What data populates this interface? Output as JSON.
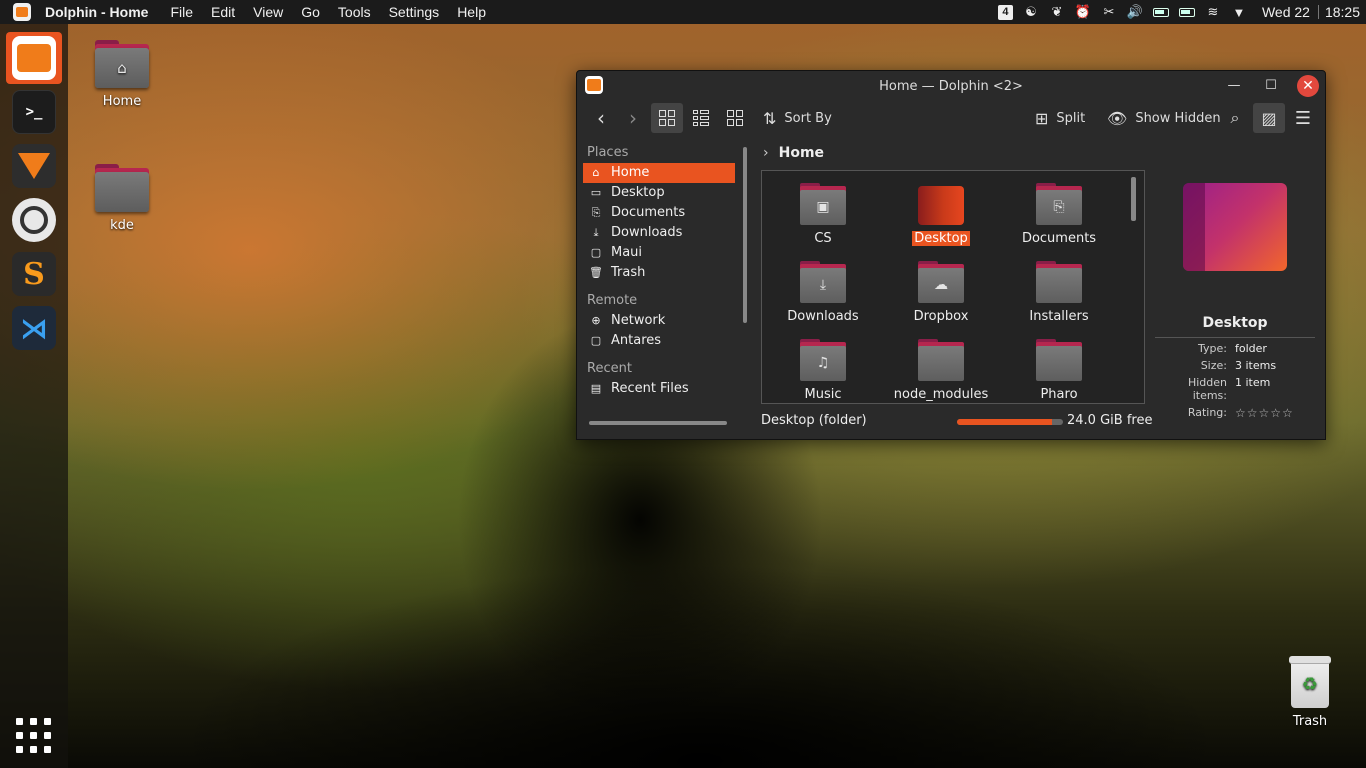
{
  "topbar": {
    "app_title": "Dolphin - Home",
    "menu": [
      "File",
      "Edit",
      "View",
      "Go",
      "Tools",
      "Settings",
      "Help"
    ],
    "tray_badge": "4",
    "date": "Wed 22",
    "time": "18:25"
  },
  "desktop": {
    "icons": [
      {
        "label": "Home",
        "icon": "home-icon"
      },
      {
        "label": "kde",
        "icon": "folder-icon"
      }
    ],
    "trash_label": "Trash"
  },
  "window": {
    "title": "Home — Dolphin <2>",
    "toolbar": {
      "sort_label": "Sort By",
      "split_label": "Split",
      "hidden_label": "Show Hidden"
    },
    "places": {
      "sections": [
        {
          "title": "Places",
          "items": [
            {
              "label": "Home",
              "icon": "⌂",
              "selected": true
            },
            {
              "label": "Desktop",
              "icon": "▭"
            },
            {
              "label": "Documents",
              "icon": "⎘"
            },
            {
              "label": "Downloads",
              "icon": "⤓"
            },
            {
              "label": "Maui",
              "icon": "▢"
            },
            {
              "label": "Trash",
              "icon": "🗑"
            }
          ]
        },
        {
          "title": "Remote",
          "items": [
            {
              "label": "Network",
              "icon": "⊕"
            },
            {
              "label": "Antares",
              "icon": "▢"
            }
          ]
        },
        {
          "title": "Recent",
          "items": [
            {
              "label": "Recent Files",
              "icon": "▤"
            }
          ]
        }
      ]
    },
    "breadcrumb": "Home",
    "files": [
      {
        "name": "CS",
        "glyph": "▣"
      },
      {
        "name": "Desktop",
        "glyph": "",
        "selected": true
      },
      {
        "name": "Documents",
        "glyph": "⎘"
      },
      {
        "name": "Downloads",
        "glyph": "⤓"
      },
      {
        "name": "Dropbox",
        "glyph": "☁"
      },
      {
        "name": "Installers",
        "glyph": ""
      },
      {
        "name": "Music",
        "glyph": "♫"
      },
      {
        "name": "node_modules",
        "glyph": ""
      },
      {
        "name": "Pharo",
        "glyph": ""
      }
    ],
    "info": {
      "name": "Desktop",
      "rows": [
        {
          "key": "Type:",
          "value": "folder"
        },
        {
          "key": "Size:",
          "value": "3 items"
        },
        {
          "key": "Hidden items:",
          "value": "1 item"
        },
        {
          "key": "Rating:",
          "value": "☆☆☆☆☆"
        }
      ]
    },
    "status": {
      "text": "Desktop (folder)",
      "free_text": "24.0 GiB free",
      "used_fraction": 0.9
    }
  },
  "colors": {
    "accent": "#e95420",
    "folder_front": "#6c6c6c",
    "folder_back": "#b6274f"
  }
}
